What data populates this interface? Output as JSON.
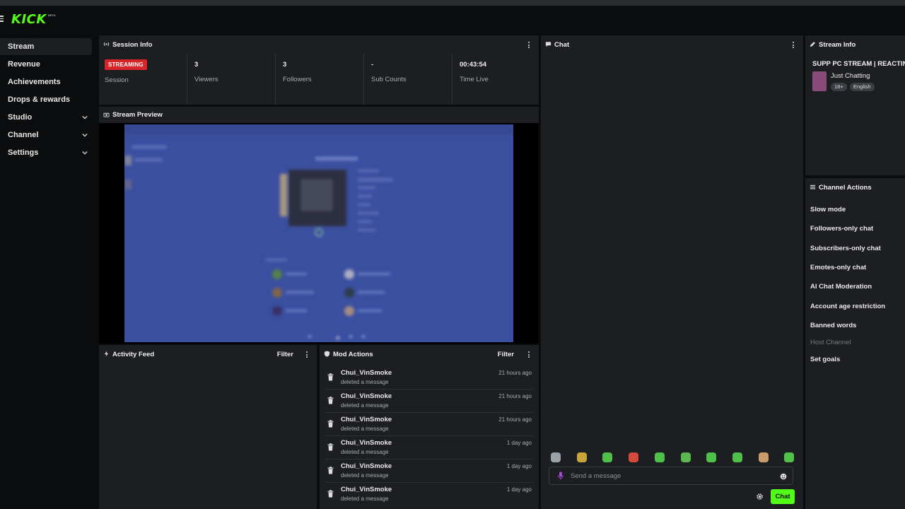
{
  "app": {
    "logo": "KICK",
    "logo_badge": "BETA"
  },
  "sidebar": {
    "items": [
      {
        "label": "Stream",
        "active": true,
        "expandable": false
      },
      {
        "label": "Revenue",
        "active": false,
        "expandable": false
      },
      {
        "label": "Achievements",
        "active": false,
        "expandable": false
      },
      {
        "label": "Drops & rewards",
        "active": false,
        "expandable": false
      },
      {
        "label": "Studio",
        "active": false,
        "expandable": true
      },
      {
        "label": "Channel",
        "active": false,
        "expandable": true
      },
      {
        "label": "Settings",
        "active": false,
        "expandable": true
      }
    ]
  },
  "session_info": {
    "title": "Session Info",
    "status_badge": "STREAMING",
    "status_label": "Session",
    "stats": [
      {
        "value": "3",
        "label": "Viewers"
      },
      {
        "value": "3",
        "label": "Followers"
      },
      {
        "value": "-",
        "label": "Sub Counts"
      },
      {
        "value": "00:43:54",
        "label": "Time Live"
      }
    ]
  },
  "stream_preview": {
    "title": "Stream Preview"
  },
  "activity_feed": {
    "title": "Activity Feed",
    "filter_label": "Filter"
  },
  "mod_actions": {
    "title": "Mod Actions",
    "filter_label": "Filter",
    "items": [
      {
        "user": "Chui_VinSmoke",
        "action": "deleted a message",
        "time": "21 hours ago"
      },
      {
        "user": "Chui_VinSmoke",
        "action": "deleted a message",
        "time": "21 hours ago"
      },
      {
        "user": "Chui_VinSmoke",
        "action": "deleted a message",
        "time": "21 hours ago"
      },
      {
        "user": "Chui_VinSmoke",
        "action": "deleted a message",
        "time": "1 day ago"
      },
      {
        "user": "Chui_VinSmoke",
        "action": "deleted a message",
        "time": "1 day ago"
      },
      {
        "user": "Chui_VinSmoke",
        "action": "deleted a message",
        "time": "1 day ago"
      }
    ]
  },
  "chat": {
    "title": "Chat",
    "input_placeholder": "Send a message",
    "send_label": "Chat",
    "emote_colors": [
      "#9aa3a8",
      "#c9a43a",
      "#4fc04a",
      "#d6483a",
      "#4fc04a",
      "#59b84f",
      "#4fc04a",
      "#4fc04a",
      "#c99a6a",
      "#4fc04a"
    ]
  },
  "stream_info": {
    "title": "Stream Info",
    "stream_title": "SUPP PC STREAM | REACTING",
    "category": "Just Chatting",
    "tags": [
      "18+",
      "English"
    ]
  },
  "channel_actions": {
    "title": "Channel Actions",
    "items": [
      {
        "label": "Slow mode",
        "enabled": true
      },
      {
        "label": "Followers-only chat",
        "enabled": true
      },
      {
        "label": "Subscribers-only chat",
        "enabled": true
      },
      {
        "label": "Emotes-only chat",
        "enabled": true
      },
      {
        "label": "AI Chat Moderation",
        "enabled": true
      },
      {
        "label": "Account age restriction",
        "enabled": true
      },
      {
        "label": "Banned words",
        "enabled": true
      },
      {
        "label": "Host Channel",
        "enabled": false
      },
      {
        "label": "Set goals",
        "enabled": true
      }
    ]
  },
  "colors": {
    "accent": "#53fc18",
    "live_badge": "#d6252b",
    "panel": "#1c1e21",
    "background": "#0b0c0d"
  }
}
